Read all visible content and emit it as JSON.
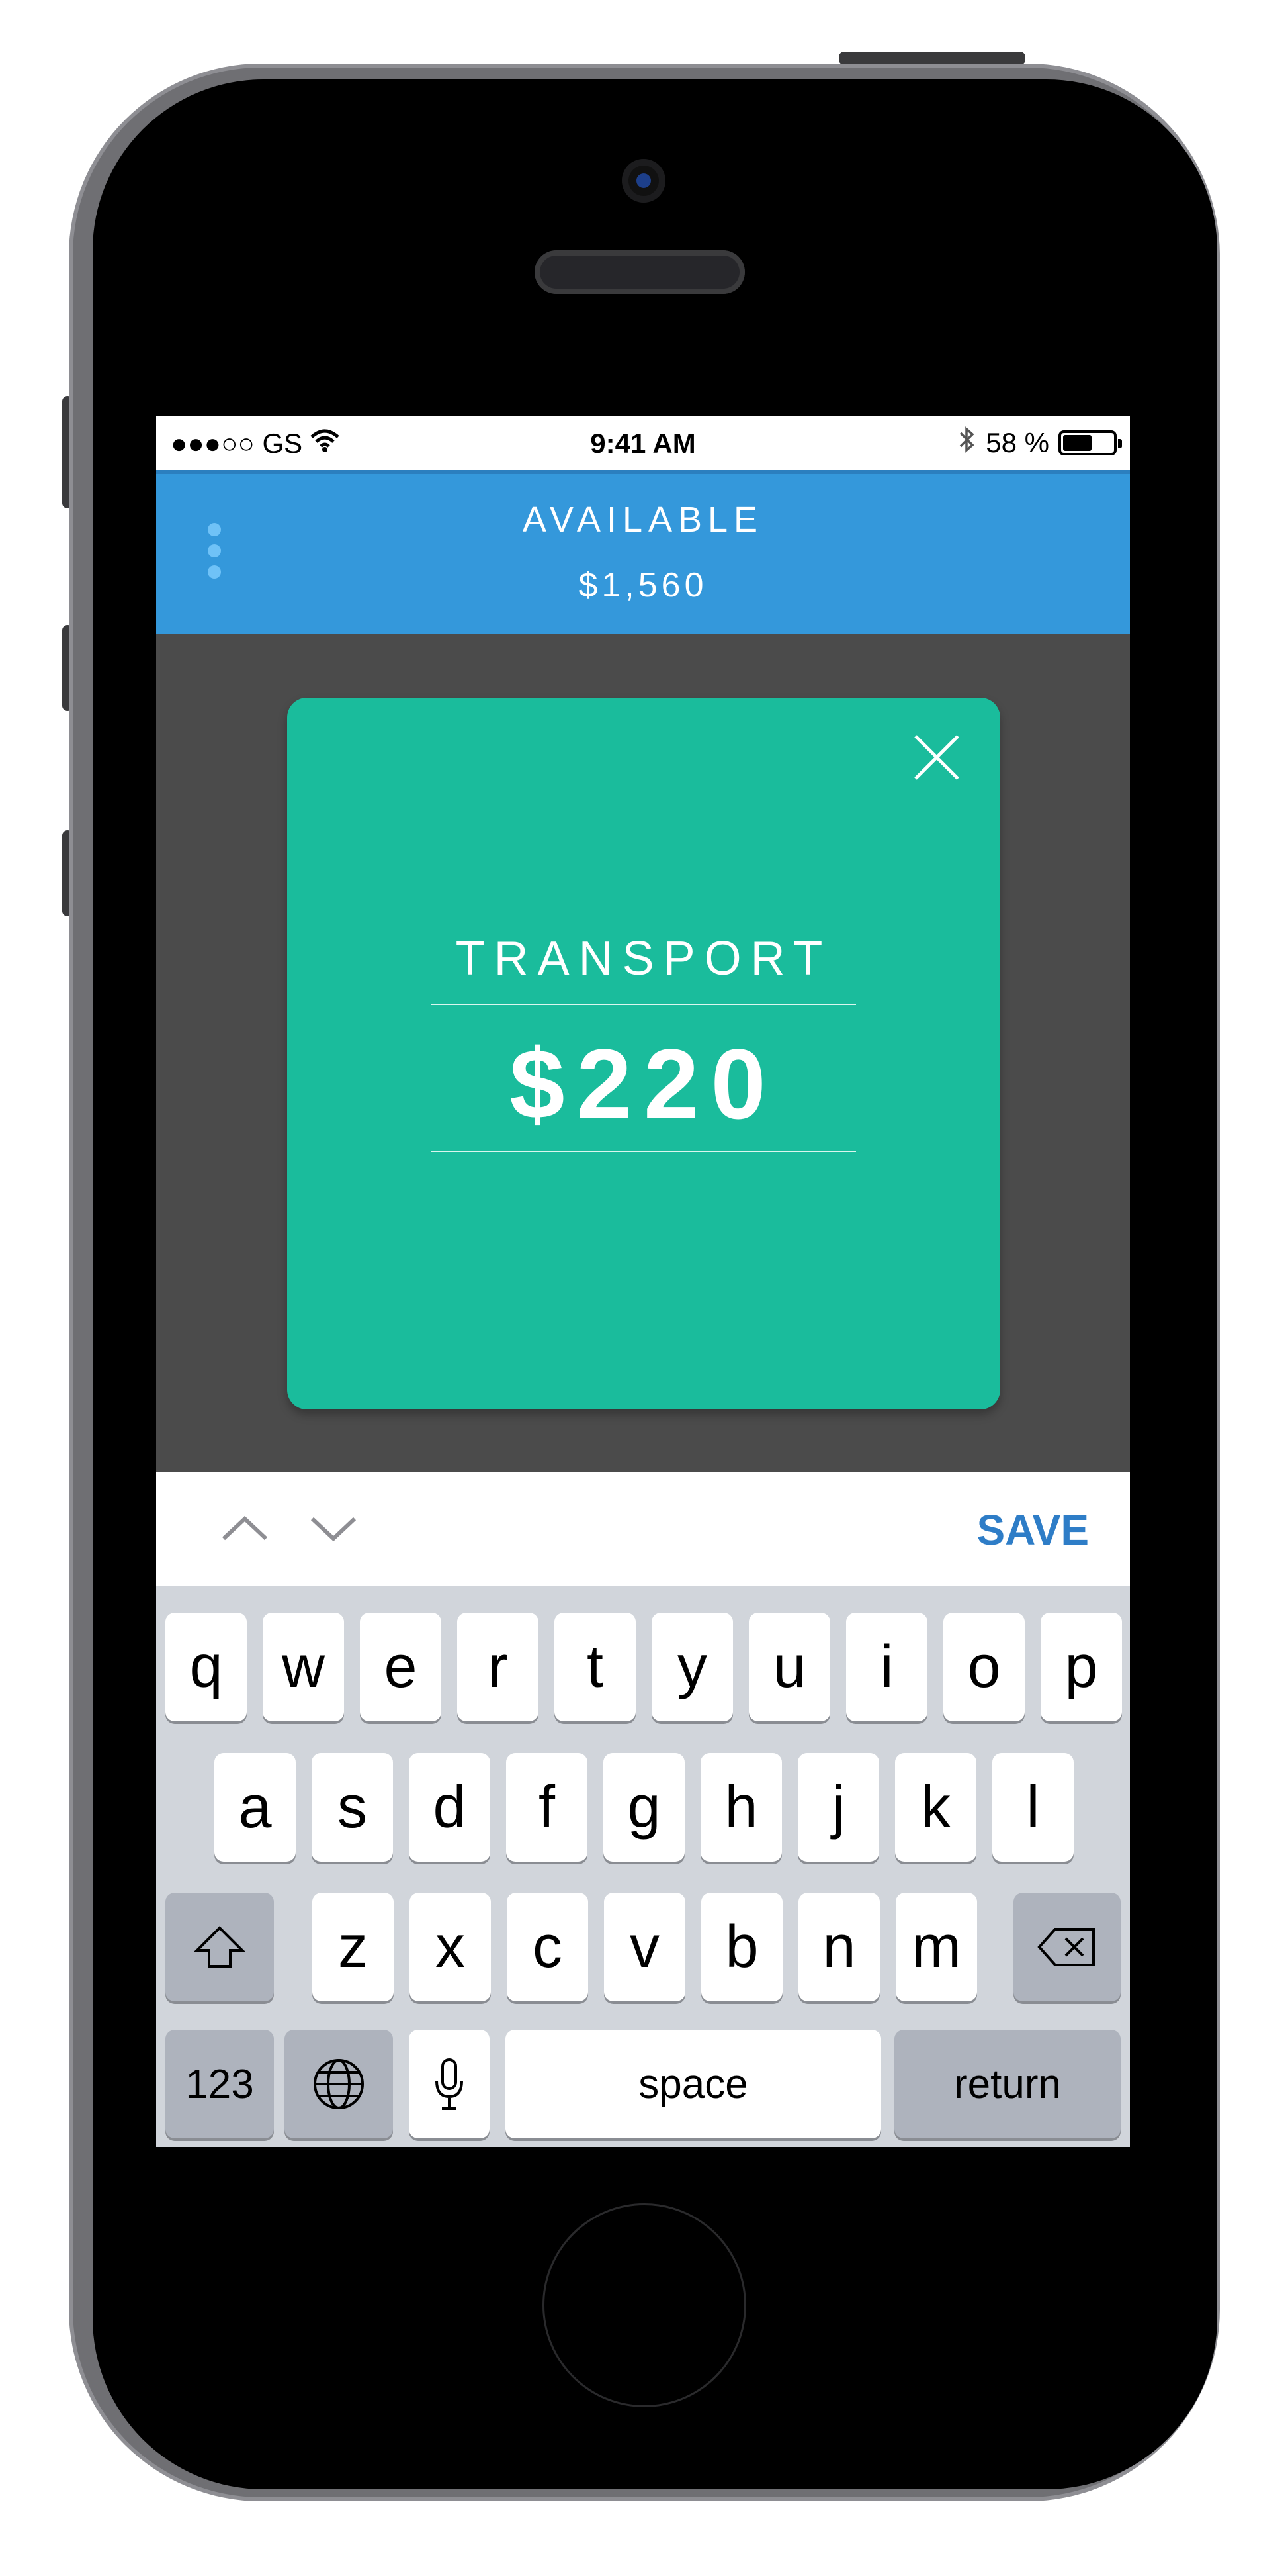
{
  "status_bar": {
    "carrier": "●●●○○ GS",
    "time": "9:41 AM",
    "battery_percent": "58 %",
    "battery_level": 0.58,
    "icons": [
      "wifi-icon",
      "bluetooth-icon",
      "battery-icon"
    ]
  },
  "header": {
    "label": "AVAILABLE",
    "amount": "$1,560",
    "color": "#3498db"
  },
  "card": {
    "title": "TRANSPORT",
    "amount": "$220",
    "color": "#1abc9c"
  },
  "toolbar": {
    "save_label": "SAVE",
    "prev_icon": "chevron-up-icon",
    "next_icon": "chevron-down-icon"
  },
  "keyboard": {
    "row1": [
      "q",
      "w",
      "e",
      "r",
      "t",
      "y",
      "u",
      "i",
      "o",
      "p"
    ],
    "row2": [
      "a",
      "s",
      "d",
      "f",
      "g",
      "h",
      "j",
      "k",
      "l"
    ],
    "row3": [
      "z",
      "x",
      "c",
      "v",
      "b",
      "n",
      "m"
    ],
    "numbers_label": "123",
    "space_label": "space",
    "return_label": "return"
  }
}
